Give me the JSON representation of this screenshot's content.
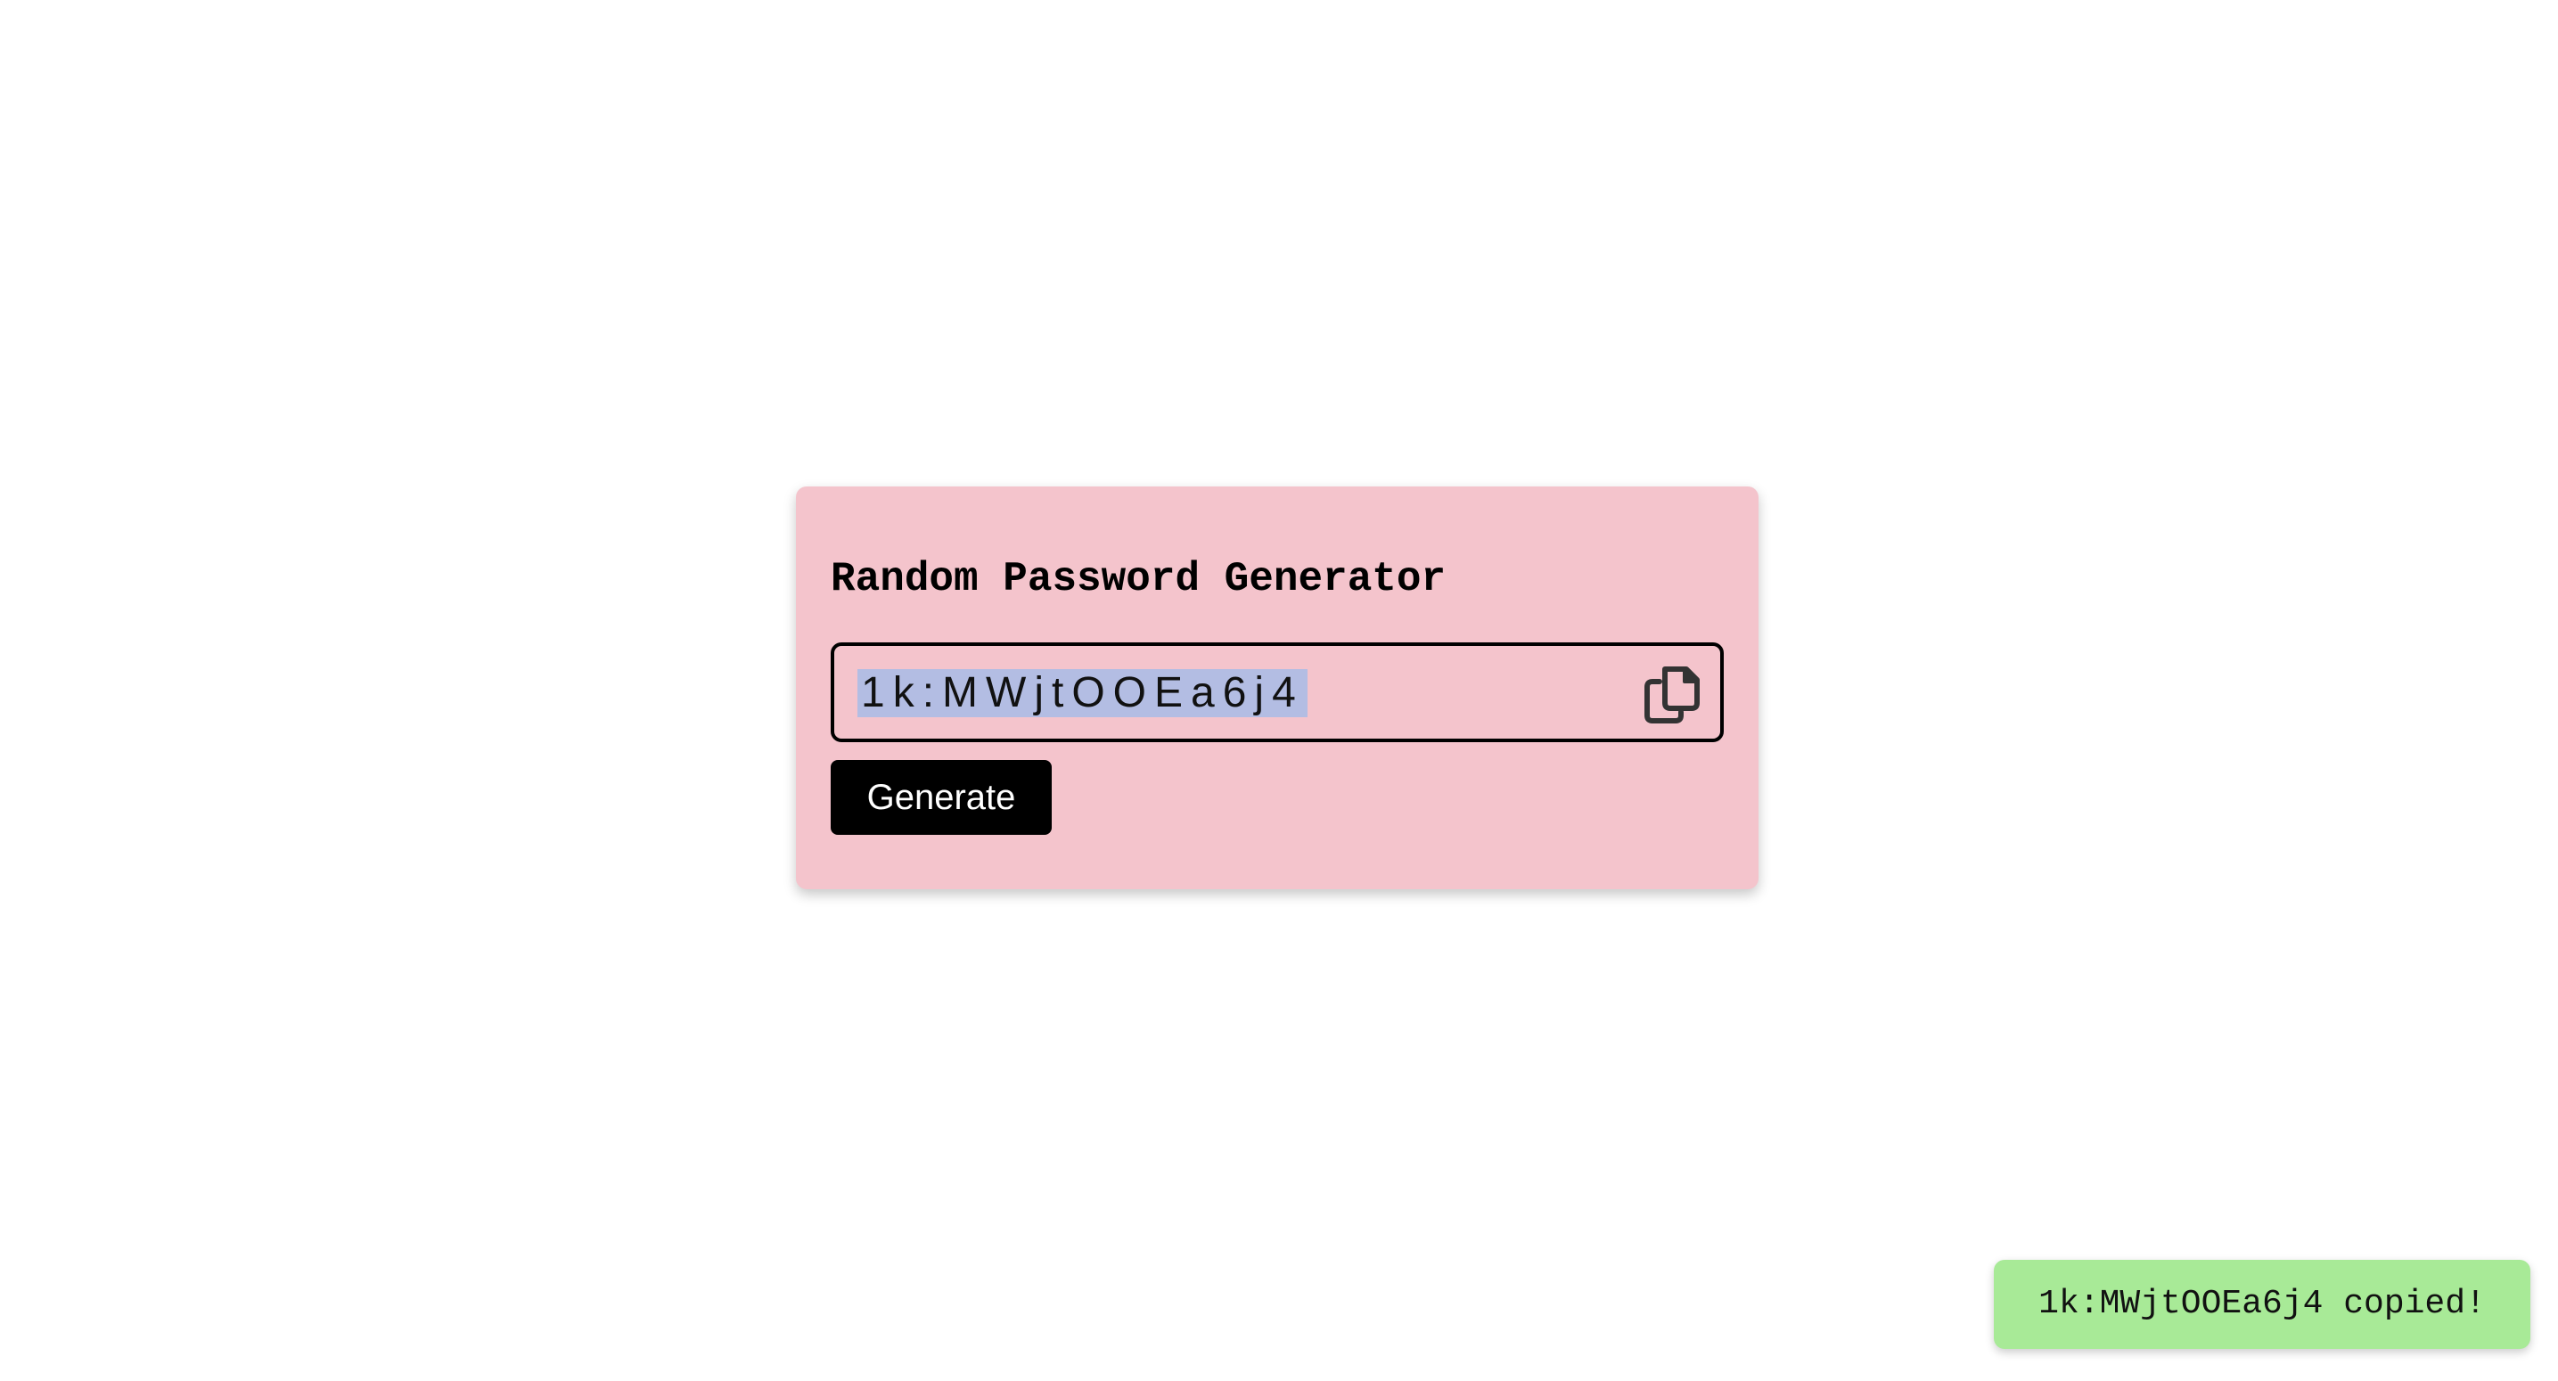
{
  "generator": {
    "title": "Random Password Generator",
    "password": "1k:MWjtOOEa6j4",
    "copy_icon": "copy-icon",
    "generate_label": "Generate"
  },
  "toast": {
    "message": "1k:MWjtOOEa6j4 copied!"
  },
  "colors": {
    "card_background": "#f4c4cc",
    "selection_highlight": "#b3bde3",
    "button_background": "#000000",
    "toast_background": "#a8ea97"
  }
}
